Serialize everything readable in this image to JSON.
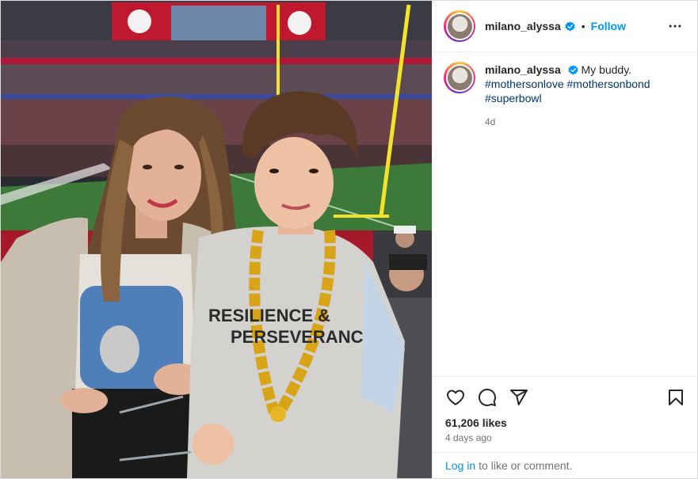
{
  "header": {
    "username": "milano_alyssa",
    "separator": "•",
    "follow_label": "Follow"
  },
  "caption": {
    "username": "milano_alyssa",
    "text": "My buddy.",
    "hashtags": [
      "#mothersonlove",
      "#mothersonbond",
      "#superbowl"
    ],
    "time": "4d"
  },
  "stats": {
    "likes": "61,206 likes",
    "age": "4 days ago"
  },
  "footer": {
    "login_link": "Log in",
    "login_text": "to like or comment."
  },
  "photo": {
    "hoodie_text_line1": "RESILIENCE &",
    "hoodie_text_line2": "PERSEVERANC"
  },
  "icons": {
    "verified": "verified-badge-icon",
    "more": "more-options-icon",
    "like": "heart-icon",
    "comment": "comment-bubble-icon",
    "share": "paper-plane-icon",
    "save": "bookmark-icon"
  },
  "colors": {
    "accent": "#0095f6",
    "hashtag": "#00376b",
    "muted": "#737373",
    "text": "#262626"
  }
}
